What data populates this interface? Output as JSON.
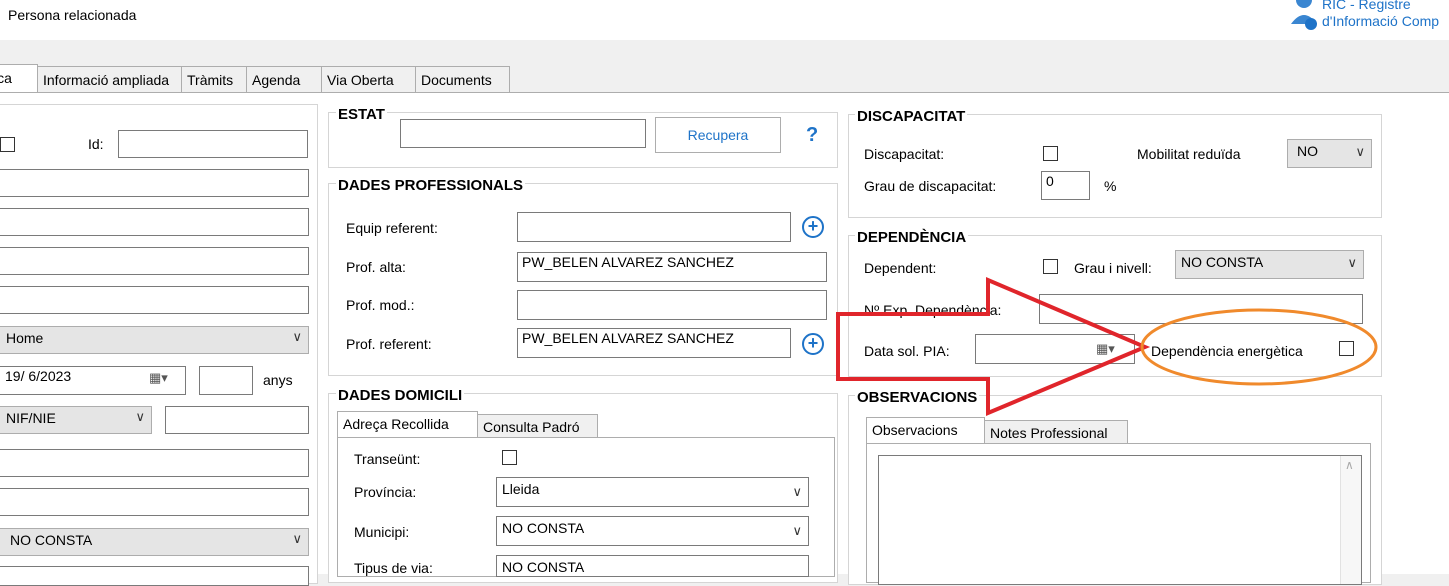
{
  "window": {
    "title": "Persona relacionada",
    "ric_line1": "RIC - Registre",
    "ric_line2": "d'Informació Comp"
  },
  "tabs": [
    "ica",
    "Informació ampliada",
    "Tràmits",
    "Agenda",
    "Via Oberta",
    "Documents"
  ],
  "left": {
    "id_label": "Id:",
    "sex_value": "Home",
    "birth_date": "19/ 6/2023",
    "age_unit": "anys",
    "doc_type": "NIF/NIE",
    "bottom_combo": "NO CONSTA"
  },
  "estat": {
    "title": "ESTAT",
    "recupera": "Recupera",
    "help": "?"
  },
  "prof": {
    "title": "DADES PROFESSIONALS",
    "equip_label": "Equip referent:",
    "alta_label": "Prof. alta:",
    "alta_value": "PW_BELEN ALVAREZ SANCHEZ",
    "mod_label": "Prof. mod.:",
    "ref_label": "Prof. referent:",
    "ref_value": "PW_BELEN ALVAREZ SANCHEZ"
  },
  "domicili": {
    "title": "DADES DOMICILI",
    "tabs": [
      "Adreça Recollida",
      "Consulta Padró"
    ],
    "transeunt_label": "Transeünt:",
    "provincia_label": "Província:",
    "provincia_value": "Lleida",
    "municipi_label": "Municipi:",
    "municipi_value": "NO CONSTA",
    "tipus_label": "Tipus de via:",
    "tipus_value": "NO CONSTA"
  },
  "discapacitat": {
    "title": "DISCAPACITAT",
    "disc_label": "Discapacitat:",
    "mob_label": "Mobilitat reduïda",
    "mob_value": "NO",
    "grau_label": "Grau de discapacitat:",
    "grau_value": "0",
    "pct": "%"
  },
  "dependencia": {
    "title": "DEPENDÈNCIA",
    "dep_label": "Dependent:",
    "grau_label": "Grau i nivell:",
    "grau_value": "NO CONSTA",
    "exp_label": "Nº Exp. Dependència:",
    "pia_label": "Data sol. PIA:",
    "energetica_label": "Dependència energètica"
  },
  "observacions": {
    "title": "OBSERVACIONS",
    "tabs": [
      "Observacions",
      "Notes Professional"
    ]
  },
  "colors": {
    "accent": "#1e73c8",
    "annotation_red": "#e0252b",
    "annotation_orange": "#f08a2c"
  }
}
